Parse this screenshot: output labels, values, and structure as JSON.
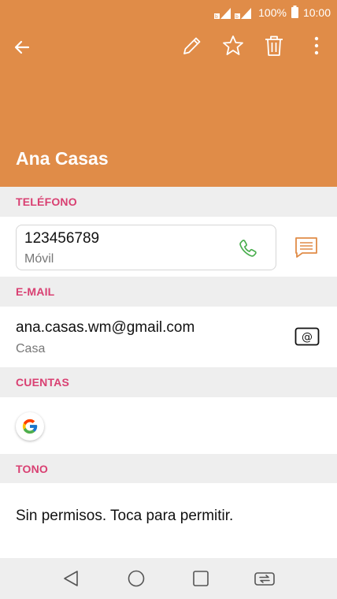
{
  "status_bar": {
    "battery_percent": "100%",
    "time": "10:00"
  },
  "contact": {
    "name": "Ana Casas"
  },
  "sections": {
    "phone_header": "TELÉFONO",
    "email_header": "E-MAIL",
    "accounts_header": "CUENTAS",
    "tone_header": "TONO"
  },
  "phone": {
    "number": "123456789",
    "type": "Móvil"
  },
  "email": {
    "address": "ana.casas.wm@gmail.com",
    "type": "Casa"
  },
  "tone": {
    "text": "Sin permisos. Toca para permitir."
  },
  "icons": {
    "back": "arrow-left-icon",
    "edit": "pencil-icon",
    "favorite": "star-outline-icon",
    "delete": "trash-icon",
    "more": "more-vert-icon",
    "call": "phone-icon",
    "message": "message-icon",
    "email": "email-at-icon",
    "account": "google-icon"
  },
  "colors": {
    "header_bg": "#e08c48",
    "section_label": "#d94072",
    "call_icon": "#4caf50",
    "message_icon": "#e08c48"
  }
}
